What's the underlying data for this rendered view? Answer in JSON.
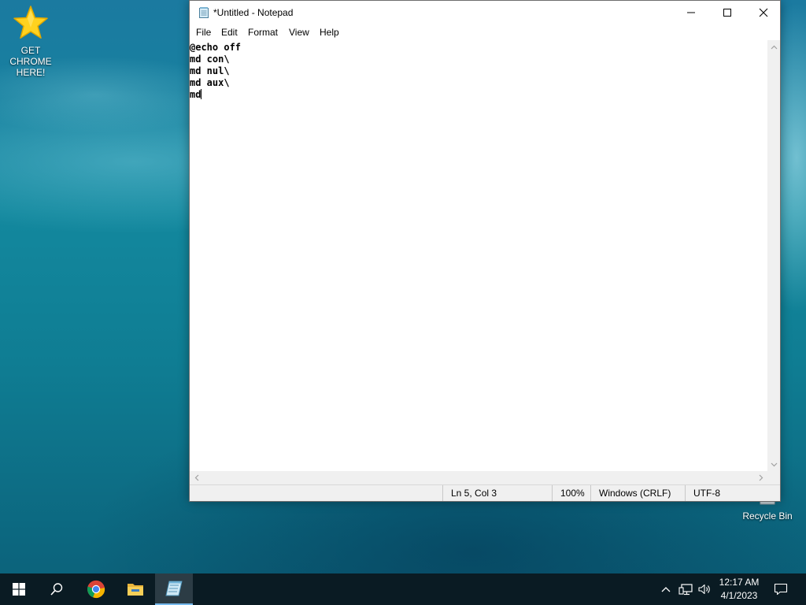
{
  "desktop": {
    "icons": [
      {
        "label": "GET CHROME HERE!",
        "icon": "star-icon"
      },
      {
        "label": "Recycle Bin",
        "icon": "recycle-bin-icon"
      }
    ]
  },
  "window": {
    "title": "*Untitled - Notepad",
    "menu": [
      "File",
      "Edit",
      "Format",
      "View",
      "Help"
    ],
    "editor_lines": [
      "@echo off",
      "md con\\",
      "md nul\\",
      "md aux\\",
      "md"
    ],
    "status": {
      "position": "Ln 5, Col 3",
      "zoom": "100%",
      "line_ending": "Windows (CRLF)",
      "encoding": "UTF-8"
    }
  },
  "taskbar": {
    "items": [
      "start-icon",
      "search-icon",
      "chrome-icon",
      "file-explorer-icon",
      "notepad-icon"
    ],
    "active_item": "notepad-icon",
    "clock": {
      "time": "12:17 AM",
      "date": "4/1/2023"
    }
  }
}
